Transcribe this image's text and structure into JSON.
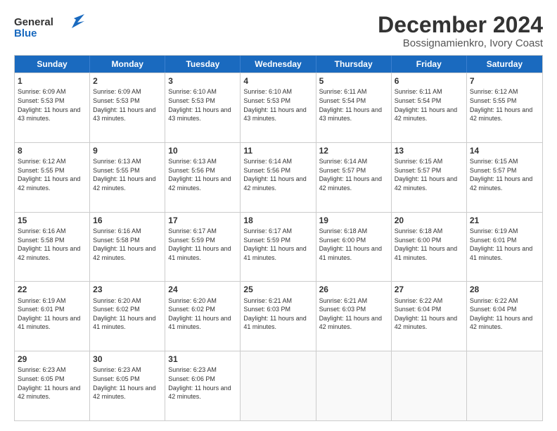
{
  "logo": {
    "line1": "General",
    "line2": "Blue"
  },
  "title": "December 2024",
  "subtitle": "Bossignamienkro, Ivory Coast",
  "days": [
    "Sunday",
    "Monday",
    "Tuesday",
    "Wednesday",
    "Thursday",
    "Friday",
    "Saturday"
  ],
  "weeks": [
    [
      {
        "day": 1,
        "sunrise": "6:09 AM",
        "sunset": "5:53 PM",
        "daylight": "11 hours and 43 minutes."
      },
      {
        "day": 2,
        "sunrise": "6:09 AM",
        "sunset": "5:53 PM",
        "daylight": "11 hours and 43 minutes."
      },
      {
        "day": 3,
        "sunrise": "6:10 AM",
        "sunset": "5:53 PM",
        "daylight": "11 hours and 43 minutes."
      },
      {
        "day": 4,
        "sunrise": "6:10 AM",
        "sunset": "5:53 PM",
        "daylight": "11 hours and 43 minutes."
      },
      {
        "day": 5,
        "sunrise": "6:11 AM",
        "sunset": "5:54 PM",
        "daylight": "11 hours and 43 minutes."
      },
      {
        "day": 6,
        "sunrise": "6:11 AM",
        "sunset": "5:54 PM",
        "daylight": "11 hours and 42 minutes."
      },
      {
        "day": 7,
        "sunrise": "6:12 AM",
        "sunset": "5:55 PM",
        "daylight": "11 hours and 42 minutes."
      }
    ],
    [
      {
        "day": 8,
        "sunrise": "6:12 AM",
        "sunset": "5:55 PM",
        "daylight": "11 hours and 42 minutes."
      },
      {
        "day": 9,
        "sunrise": "6:13 AM",
        "sunset": "5:55 PM",
        "daylight": "11 hours and 42 minutes."
      },
      {
        "day": 10,
        "sunrise": "6:13 AM",
        "sunset": "5:56 PM",
        "daylight": "11 hours and 42 minutes."
      },
      {
        "day": 11,
        "sunrise": "6:14 AM",
        "sunset": "5:56 PM",
        "daylight": "11 hours and 42 minutes."
      },
      {
        "day": 12,
        "sunrise": "6:14 AM",
        "sunset": "5:57 PM",
        "daylight": "11 hours and 42 minutes."
      },
      {
        "day": 13,
        "sunrise": "6:15 AM",
        "sunset": "5:57 PM",
        "daylight": "11 hours and 42 minutes."
      },
      {
        "day": 14,
        "sunrise": "6:15 AM",
        "sunset": "5:57 PM",
        "daylight": "11 hours and 42 minutes."
      }
    ],
    [
      {
        "day": 15,
        "sunrise": "6:16 AM",
        "sunset": "5:58 PM",
        "daylight": "11 hours and 42 minutes."
      },
      {
        "day": 16,
        "sunrise": "6:16 AM",
        "sunset": "5:58 PM",
        "daylight": "11 hours and 42 minutes."
      },
      {
        "day": 17,
        "sunrise": "6:17 AM",
        "sunset": "5:59 PM",
        "daylight": "11 hours and 41 minutes."
      },
      {
        "day": 18,
        "sunrise": "6:17 AM",
        "sunset": "5:59 PM",
        "daylight": "11 hours and 41 minutes."
      },
      {
        "day": 19,
        "sunrise": "6:18 AM",
        "sunset": "6:00 PM",
        "daylight": "11 hours and 41 minutes."
      },
      {
        "day": 20,
        "sunrise": "6:18 AM",
        "sunset": "6:00 PM",
        "daylight": "11 hours and 41 minutes."
      },
      {
        "day": 21,
        "sunrise": "6:19 AM",
        "sunset": "6:01 PM",
        "daylight": "11 hours and 41 minutes."
      }
    ],
    [
      {
        "day": 22,
        "sunrise": "6:19 AM",
        "sunset": "6:01 PM",
        "daylight": "11 hours and 41 minutes."
      },
      {
        "day": 23,
        "sunrise": "6:20 AM",
        "sunset": "6:02 PM",
        "daylight": "11 hours and 41 minutes."
      },
      {
        "day": 24,
        "sunrise": "6:20 AM",
        "sunset": "6:02 PM",
        "daylight": "11 hours and 41 minutes."
      },
      {
        "day": 25,
        "sunrise": "6:21 AM",
        "sunset": "6:03 PM",
        "daylight": "11 hours and 41 minutes."
      },
      {
        "day": 26,
        "sunrise": "6:21 AM",
        "sunset": "6:03 PM",
        "daylight": "11 hours and 42 minutes."
      },
      {
        "day": 27,
        "sunrise": "6:22 AM",
        "sunset": "6:04 PM",
        "daylight": "11 hours and 42 minutes."
      },
      {
        "day": 28,
        "sunrise": "6:22 AM",
        "sunset": "6:04 PM",
        "daylight": "11 hours and 42 minutes."
      }
    ],
    [
      {
        "day": 29,
        "sunrise": "6:23 AM",
        "sunset": "6:05 PM",
        "daylight": "11 hours and 42 minutes."
      },
      {
        "day": 30,
        "sunrise": "6:23 AM",
        "sunset": "6:05 PM",
        "daylight": "11 hours and 42 minutes."
      },
      {
        "day": 31,
        "sunrise": "6:23 AM",
        "sunset": "6:06 PM",
        "daylight": "11 hours and 42 minutes."
      },
      null,
      null,
      null,
      null
    ]
  ]
}
